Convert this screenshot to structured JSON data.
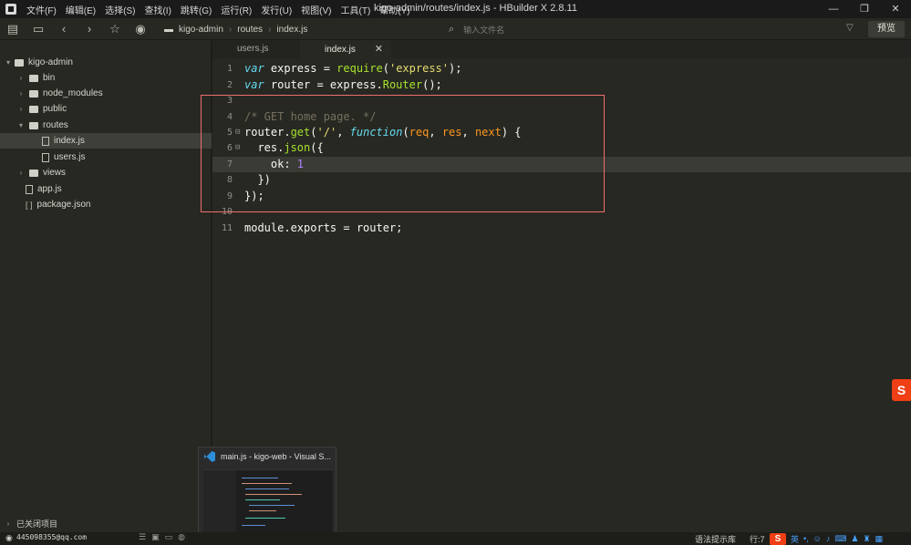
{
  "window": {
    "title": "kigo-admin/routes/index.js - HBuilder X 2.8.11",
    "menu": [
      "文件(F)",
      "编辑(E)",
      "选择(S)",
      "查找(I)",
      "跳转(G)",
      "运行(R)",
      "发行(U)",
      "视图(V)",
      "工具(T)",
      "帮助(Y)"
    ],
    "controls": {
      "minimize": "—",
      "restore": "❐",
      "close": "✕"
    }
  },
  "toolbar": {
    "icons": [
      "new-file-icon",
      "save-icon",
      "back-icon",
      "forward-icon",
      "star-icon",
      "run-icon"
    ],
    "breadcrumb": [
      "kigo-admin",
      "routes",
      "index.js"
    ],
    "file_search_placeholder": "输入文件名",
    "preview_label": "预览"
  },
  "sidebar": {
    "project": "kigo-admin",
    "items": [
      {
        "label": "bin",
        "type": "folder"
      },
      {
        "label": "node_modules",
        "type": "folder"
      },
      {
        "label": "public",
        "type": "folder"
      },
      {
        "label": "routes",
        "type": "folder",
        "open": true
      },
      {
        "label": "index.js",
        "type": "file",
        "selected": true
      },
      {
        "label": "users.js",
        "type": "file"
      },
      {
        "label": "views",
        "type": "folder"
      },
      {
        "label": "app.js",
        "type": "file"
      },
      {
        "label": "package.json",
        "type": "json"
      }
    ],
    "closed_projects_label": "已关闭项目"
  },
  "tabs": [
    {
      "label": "users.js",
      "active": false
    },
    {
      "label": "index.js",
      "active": true,
      "close": "✕"
    }
  ],
  "editor": {
    "current_line": 7,
    "line_numbers": [
      "1",
      "2",
      "3",
      "4",
      "5",
      "6",
      "7",
      "8",
      "9",
      "10",
      "11"
    ]
  },
  "thumbnail": {
    "title": "main.js - kigo-web - Visual S..."
  },
  "statusbar": {
    "user": "445098355@qq.com",
    "hint": "语法提示库",
    "position": "行:7",
    "ime": {
      "logo": "S",
      "lang": "英"
    }
  },
  "side_widget": {
    "logo": "S"
  },
  "colors": {
    "editor_bg": "#272822",
    "highlight_box": "#ec6f6f",
    "keyword": "#66d9ef",
    "function": "#a6e22e",
    "string": "#e6db74",
    "comment": "#75715e",
    "number": "#ae81ff"
  }
}
